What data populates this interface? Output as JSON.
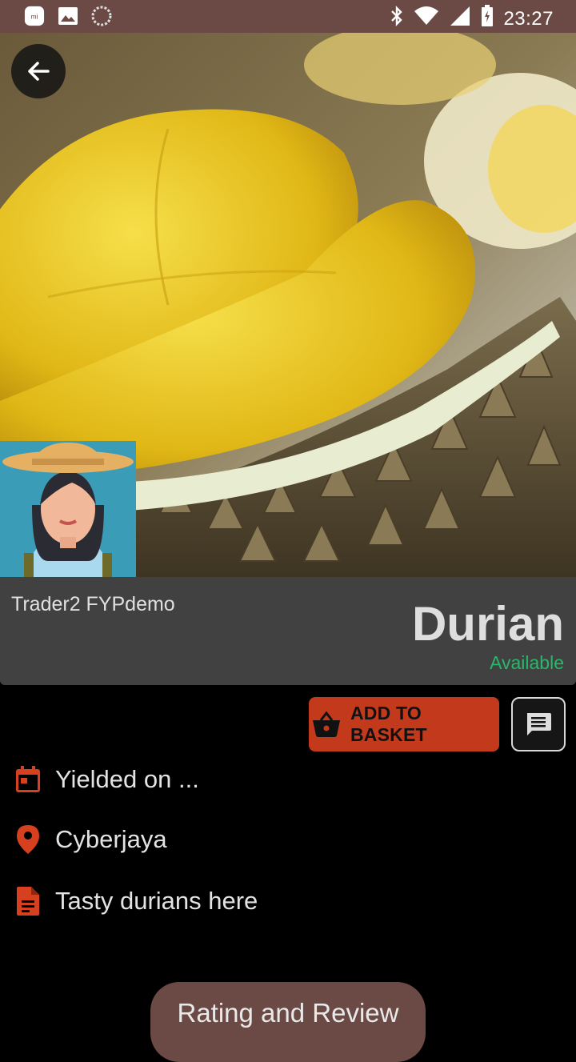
{
  "status_bar": {
    "time": "23:27",
    "left_icons": [
      "mi-icon",
      "image-icon",
      "sync-icon"
    ],
    "right_icons": [
      "bluetooth-icon",
      "wifi-icon",
      "signal-icon",
      "battery-icon"
    ]
  },
  "product": {
    "trader": "Trader2 FYPdemo",
    "name": "Durian",
    "availability": "Available"
  },
  "actions": {
    "add_to_basket": "ADD TO BASKET"
  },
  "details": {
    "yielded": "Yielded on  ...",
    "location": "Cyberjaya",
    "description": "Tasty durians here"
  },
  "rating_button": "Rating and Review",
  "colors": {
    "status_bar": "#6b4a45",
    "accent_red": "#c2391b",
    "available_green": "#28b86b",
    "panel": "#414141"
  }
}
